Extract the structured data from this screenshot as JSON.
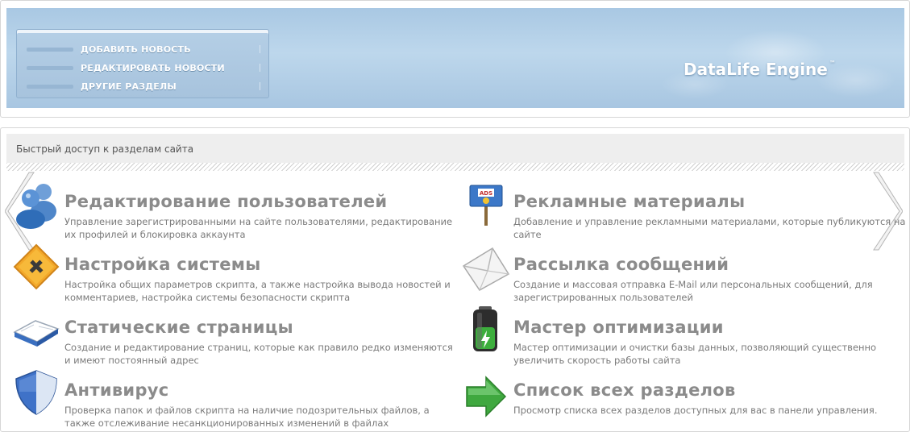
{
  "header": {
    "menu": [
      {
        "label": "ДОБАВИТЬ НОВОСТЬ"
      },
      {
        "label": "РЕДАКТИРОВАТЬ НОВОСТИ"
      },
      {
        "label": "ДРУГИЕ РАЗДЕЛЫ"
      }
    ],
    "logo": {
      "text": "DataLife Engine",
      "mark": "™"
    }
  },
  "quick_access": {
    "title": "Быстрый доступ к разделам сайта",
    "tiles": [
      {
        "title": "Редактирование пользователей",
        "desc": "Управление зарегистрированными на сайте пользователями, редактирование их профилей и блокировка аккаунта",
        "icon": "users-icon"
      },
      {
        "title": "Рекламные материалы",
        "desc": "Добавление и управление рекламными материалами, которые публикуются на сайте",
        "icon": "ads-sign-icon"
      },
      {
        "title": "Настройка системы",
        "desc": "Настройка общих параметров скрипта, а также настройка вывода новостей и комментариев, настройка системы безопасности скрипта",
        "icon": "tools-sign-icon"
      },
      {
        "title": "Рассылка сообщений",
        "desc": "Создание и массовая отправка E-Mail или персональных сообщений, для зарегистрированных пользователей",
        "icon": "envelope-icon"
      },
      {
        "title": "Статические страницы",
        "desc": "Создание и редактирование страниц, которые как правило редко изменяются и имеют постоянный адрес",
        "icon": "open-book-icon"
      },
      {
        "title": "Мастер оптимизации",
        "desc": "Мастер оптимизации и очистки базы данных, позволяющий существенно увеличить скорость работы сайта",
        "icon": "battery-icon"
      },
      {
        "title": "Антивирус",
        "desc": "Проверка папок и файлов скрипта на наличие подозрительных файлов, а также отслеживание несанкционированных изменений в файлах",
        "icon": "shield-icon"
      },
      {
        "title": "Список всех разделов",
        "desc": "Просмотр списка всех разделов доступных для вас в панели управления.",
        "icon": "green-arrow-icon"
      }
    ]
  },
  "colors": {
    "banner": "#b3d0e9",
    "title_text": "#8b8b8b",
    "desc_text": "#7a7a7a"
  }
}
